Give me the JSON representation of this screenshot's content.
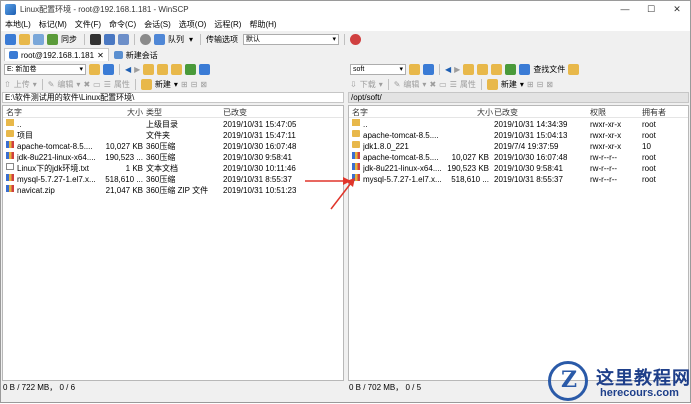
{
  "window": {
    "title": "Linux配置环境 - root@192.168.1.181 - WinSCP",
    "controls": [
      "—",
      "☐",
      "✕"
    ]
  },
  "menu": [
    "本地(L)",
    "标记(M)",
    "文件(F)",
    "命令(C)",
    "会话(S)",
    "选项(O)",
    "远程(R)",
    "帮助(H)"
  ],
  "toolbar": {
    "sync_label": "同步",
    "queue_label": "队列",
    "transfer_options_label": "传输选项",
    "transfer_preset": "默认"
  },
  "tabs": [
    {
      "label": "root@192.168.1.181"
    },
    {
      "label": "新建会话"
    }
  ],
  "left": {
    "drive": "E: 新加卷",
    "upload_label": "上传",
    "edit_label": "编辑",
    "properties_label": "属性",
    "new_label": "新建",
    "path": "E:\\软件测试用的软件\\Linux配置环境\\",
    "columns": [
      "名字",
      "大小",
      "类型",
      "已改变"
    ],
    "files": [
      {
        "name": "..",
        "size": "",
        "type": "上级目录",
        "modified": "2019/10/31  15:47:05",
        "icon": "up"
      },
      {
        "name": "项目",
        "size": "",
        "type": "文件夹",
        "modified": "2019/10/31  15:47:11",
        "icon": "folder"
      },
      {
        "name": "apache-tomcat-8.5....",
        "size": "10,027 KB",
        "type": "360压缩",
        "modified": "2019/10/30  16:07:48",
        "icon": "archive"
      },
      {
        "name": "jdk-8u221-linux-x64....",
        "size": "190,523 ...",
        "type": "360压缩",
        "modified": "2019/10/30  9:58:41",
        "icon": "archive"
      },
      {
        "name": "Linux下的jdk环境.txt",
        "size": "1 KB",
        "type": "文本文档",
        "modified": "2019/10/30  10:11:46",
        "icon": "text"
      },
      {
        "name": "mysql-5.7.27-1.el7.x...",
        "size": "518,610 ...",
        "type": "360压缩",
        "modified": "2019/10/31  8:55:37",
        "icon": "archive"
      },
      {
        "name": "navicat.zip",
        "size": "21,047 KB",
        "type": "360压缩 ZIP 文件",
        "modified": "2019/10/31  10:51:23",
        "icon": "archive"
      }
    ],
    "status": "0 B / 722 MB，  0 / 6"
  },
  "right": {
    "dir": "soft",
    "download_label": "下载",
    "edit_label": "编辑",
    "properties_label": "属性",
    "new_label": "新建",
    "find_label": "查找文件",
    "path": "/opt/soft/",
    "columns": [
      "名字",
      "大小",
      "已改变",
      "权限",
      "拥有者"
    ],
    "files": [
      {
        "name": "..",
        "size": "",
        "modified": "2019/10/31 14:34:39",
        "perms": "rwxr-xr-x",
        "owner": "root",
        "icon": "up"
      },
      {
        "name": "apache-tomcat-8.5....",
        "size": "",
        "modified": "2019/10/31 15:04:13",
        "perms": "rwxr-xr-x",
        "owner": "root",
        "icon": "folder"
      },
      {
        "name": "jdk1.8.0_221",
        "size": "",
        "modified": "2019/7/4 19:37:59",
        "perms": "rwxr-xr-x",
        "owner": "10",
        "icon": "folder"
      },
      {
        "name": "apache-tomcat-8.5....",
        "size": "10,027 KB",
        "modified": "2019/10/30 16:07:48",
        "perms": "rw-r--r--",
        "owner": "root",
        "icon": "archive"
      },
      {
        "name": "jdk-8u221-linux-x64....",
        "size": "190,523 KB",
        "modified": "2019/10/30 9:58:41",
        "perms": "rw-r--r--",
        "owner": "root",
        "icon": "archive"
      },
      {
        "name": "mysql-5.7.27-1.el7.x...",
        "size": "518,610 ...",
        "modified": "2019/10/31 8:55:37",
        "perms": "rw-r--r--",
        "owner": "root",
        "icon": "archive"
      }
    ],
    "status": "0 B / 702 MB，  0 / 5"
  },
  "watermark": {
    "title": "这里教程网",
    "url": "herecours.com",
    "logo_letter": "Z"
  },
  "colors": {
    "accent": "#1e5fb3",
    "arrow": "#e0352b",
    "folder": "#e8b84a"
  }
}
